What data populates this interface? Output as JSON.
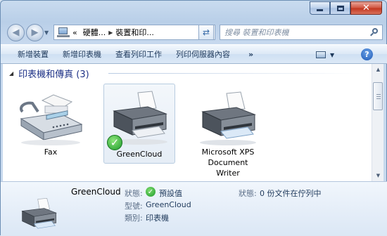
{
  "window": {
    "caption_buttons": {
      "minimize_icon": "minimize-icon",
      "maximize_icon": "maximize-icon",
      "close_icon": "close-icon",
      "close_glyph": "✕"
    }
  },
  "navigation": {
    "back_glyph": "◀",
    "forward_glyph": "▶",
    "history_dropdown_glyph": "▼",
    "breadcrumb": {
      "overflow": "«",
      "items": [
        "硬體...",
        "裝置和印..."
      ],
      "separator": "▶",
      "dropdown_glyph": "▼"
    },
    "refresh_glyph": "⇄",
    "search": {
      "placeholder": "搜尋 裝置和印表機"
    }
  },
  "toolbar": {
    "items": [
      "新增裝置",
      "新增印表機",
      "查看列印工作",
      "列印伺服器內容"
    ],
    "more_label": "»",
    "view_caret": "▼",
    "help_label": "?"
  },
  "content": {
    "group": {
      "toggle_glyph": "◢",
      "title": "印表機和傳真 (3)"
    },
    "devices": [
      {
        "name": "Fax",
        "icon": "fax-icon",
        "selected": false
      },
      {
        "name": "GreenCloud",
        "icon": "printer-icon",
        "selected": true,
        "default_badge": "check-icon"
      },
      {
        "name_lines": [
          "Microsoft XPS",
          "Document",
          "Writer"
        ],
        "icon": "printer-icon",
        "selected": false
      }
    ],
    "scrollbar": {
      "up_glyph": "▲",
      "down_glyph": "▼"
    }
  },
  "details": {
    "device_name": "GreenCloud",
    "status_label": "狀態:",
    "status_value": "預設值",
    "status_icon": "check-icon",
    "model_label": "型號:",
    "model_value": "GreenCloud",
    "category_label": "類別:",
    "category_value": "印表機",
    "queue_label": "狀態:",
    "queue_value": "0 份文件在佇列中"
  },
  "colors": {
    "accent": "#1e3287",
    "toolbar_text": "#1e395b",
    "default_check": "#1d9b2a"
  }
}
